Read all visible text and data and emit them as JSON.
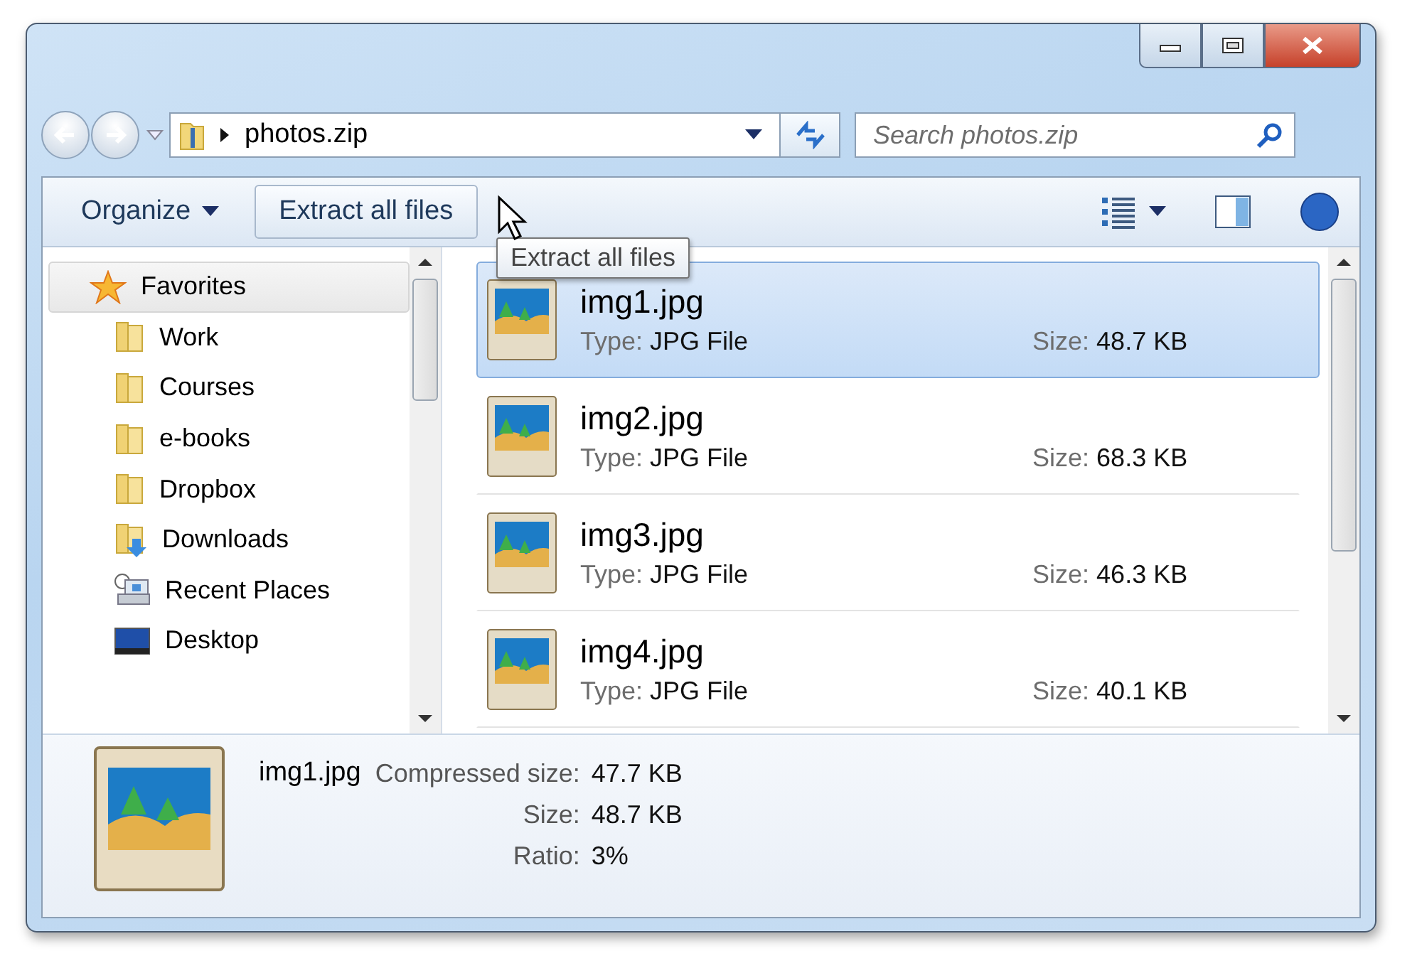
{
  "address": {
    "path": "photos.zip"
  },
  "search": {
    "placeholder": "Search photos.zip"
  },
  "toolbar": {
    "buttons": [
      {
        "label": "Organize",
        "kind": "menu",
        "hovered": false
      },
      {
        "label": "Extract all files",
        "kind": "button",
        "hovered": true
      }
    ]
  },
  "tooltip": "Extract all files",
  "sidebar": {
    "items": [
      {
        "label": "Favorites",
        "kind": "star",
        "selected": true,
        "children": [
          {
            "label": "Work",
            "kind": "folder",
            "selected": false
          },
          {
            "label": "Courses",
            "kind": "folder",
            "selected": false
          },
          {
            "label": "e-books",
            "kind": "folder",
            "selected": false
          },
          {
            "label": "Dropbox",
            "kind": "folder",
            "selected": false
          },
          {
            "label": "Downloads",
            "kind": "downloads",
            "selected": false
          },
          {
            "label": "Recent Places",
            "kind": "recent",
            "selected": false
          },
          {
            "label": "Desktop",
            "kind": "desktop",
            "selected": false
          }
        ]
      }
    ]
  },
  "files": [
    {
      "name": "img1.jpg",
      "type_label": "Type:",
      "type": "JPG File",
      "size_label": "Size:",
      "size": "48.7 KB",
      "selected": true
    },
    {
      "name": "img2.jpg",
      "type_label": "Type:",
      "type": "JPG File",
      "size_label": "Size:",
      "size": "68.3 KB",
      "selected": false
    },
    {
      "name": "img3.jpg",
      "type_label": "Type:",
      "type": "JPG File",
      "size_label": "Size:",
      "size": "46.3 KB",
      "selected": false
    },
    {
      "name": "img4.jpg",
      "type_label": "Type:",
      "type": "JPG File",
      "size_label": "Size:",
      "size": "40.1 KB",
      "selected": false
    }
  ],
  "details": {
    "name": "img1.jpg",
    "fields": [
      {
        "label": "Compressed size:",
        "value": "47.7 KB"
      },
      {
        "label": "Size:",
        "value": "48.7 KB"
      },
      {
        "label": "Ratio:",
        "value": "3%"
      }
    ]
  }
}
